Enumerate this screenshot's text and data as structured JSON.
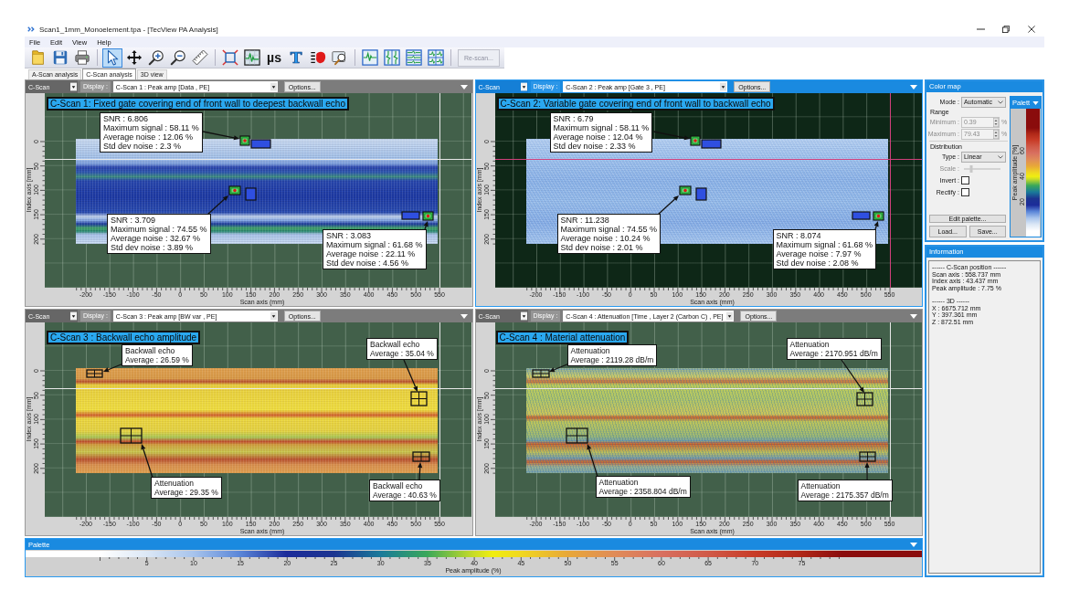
{
  "window": {
    "title": "Scan1_1mm_Monoelement.tpa - [TecView PA Analysis]"
  },
  "menu": [
    "File",
    "Edit",
    "View",
    "Help"
  ],
  "toolbar": {
    "tools": [
      {
        "selected": false
      },
      {
        "selected": false
      },
      {
        "selected": false
      },
      {
        "selected": true
      },
      {
        "selected": false
      },
      {
        "selected": false
      },
      {
        "selected": false
      },
      {
        "selected": false
      },
      {
        "selected": false
      },
      {
        "selected": false
      },
      {
        "label": "µs",
        "selected": false
      },
      {
        "label": "T",
        "selected": false
      },
      {
        "selected": false
      },
      {
        "selected": false
      },
      {
        "selected": false
      },
      {
        "selected": false
      },
      {
        "selected": false
      },
      {
        "selected": false
      }
    ],
    "rescan_button": {
      "label": "Re-scan...",
      "disabled": true
    }
  },
  "tabs": [
    {
      "label": "A-Scan analysis",
      "selected": false
    },
    {
      "label": "C-Scan analysis",
      "selected": true
    },
    {
      "label": "3D view",
      "selected": false
    }
  ],
  "cscan_panels": [
    {
      "selected": false,
      "view": "C-Scan",
      "display_label": "Display :",
      "display": "C-Scan 1 : Peak amp [Data , PE]",
      "options": "Options...",
      "title": "C-Scan 1: Fixed gate covering end of front wall to deepest backwall echo",
      "annotations": [
        {
          "kind": "snr",
          "lines": [
            "SNR : 6.806",
            "Maximum signal : 58.11 %",
            "Average noise : 12.06 %",
            "Std dev noise : 2.3 %"
          ]
        },
        {
          "kind": "snr",
          "lines": [
            "SNR : 3.709",
            "Maximum signal : 74.55 %",
            "Average noise : 32.67 %",
            "Std dev noise : 3.89 %"
          ]
        },
        {
          "kind": "snr",
          "lines": [
            "SNR : 3.083",
            "Maximum signal : 61.68 %",
            "Average noise : 22.11 %",
            "Std dev noise : 4.56 %"
          ]
        }
      ],
      "y_axis": {
        "label": "Index axis [mm]",
        "ticks": [
          "0",
          "50",
          "100",
          "150",
          "200"
        ]
      },
      "x_axis": {
        "label": "Scan axis (mm)",
        "ticks": [
          "-200",
          "-150",
          "-100",
          "-50",
          "0",
          "50",
          "100",
          "150",
          "200",
          "250",
          "300",
          "350",
          "400",
          "450",
          "500",
          "550"
        ]
      }
    },
    {
      "selected": true,
      "view": "C-Scan",
      "display_label": "Display :",
      "display": "C-Scan 2 : Peak amp [Gate 3 , PE]",
      "options": "Options...",
      "title": "C-Scan 2: Variable gate covering end of front wall to backwall echo",
      "annotations": [
        {
          "kind": "snr",
          "lines": [
            "SNR : 6.79",
            "Maximum signal : 58.11 %",
            "Average noise : 12.04 %",
            "Std dev noise : 2.33 %"
          ]
        },
        {
          "kind": "snr",
          "lines": [
            "SNR : 11.238",
            "Maximum signal : 74.55 %",
            "Average noise : 10.24 %",
            "Std dev noise : 2.01 %"
          ]
        },
        {
          "kind": "snr",
          "lines": [
            "SNR : 8.074",
            "Maximum signal : 61.68 %",
            "Average noise : 7.97 %",
            "Std dev noise : 2.08 %"
          ]
        }
      ],
      "y_axis": {
        "label": "Index axis [mm]",
        "ticks": [
          "0",
          "50",
          "100",
          "150",
          "200"
        ]
      },
      "x_axis": {
        "label": "Scan axis (mm)",
        "ticks": [
          "-200",
          "-150",
          "-100",
          "-50",
          "0",
          "50",
          "100",
          "150",
          "200",
          "250",
          "300",
          "350",
          "400",
          "450",
          "500",
          "550"
        ]
      }
    },
    {
      "selected": false,
      "view": "C-Scan",
      "display_label": "Display :",
      "display": "C-Scan 3 : Peak amp [BW var , PE]",
      "options": "Options...",
      "title": "C-Scan 3 : Backwall echo amplitude",
      "annotations": [
        {
          "kind": "average",
          "lines": [
            "Backwall echo",
            "Average : 26.59 %"
          ]
        },
        {
          "kind": "average",
          "lines": [
            "Backwall echo",
            "Average : 35.04 %"
          ]
        },
        {
          "kind": "average",
          "lines": [
            "Attenuation",
            "Average : 29.35 %"
          ]
        },
        {
          "kind": "average",
          "lines": [
            "Backwall echo",
            "Average : 40.63 %"
          ]
        }
      ],
      "y_axis": {
        "label": "Index axis [mm]",
        "ticks": [
          "0",
          "50",
          "100",
          "150",
          "200"
        ]
      },
      "x_axis": {
        "label": "Scan axis (mm)",
        "ticks": [
          "-200",
          "-150",
          "-100",
          "-50",
          "0",
          "50",
          "100",
          "150",
          "200",
          "250",
          "300",
          "350",
          "400",
          "450",
          "500",
          "550"
        ]
      }
    },
    {
      "selected": false,
      "view": "C-Scan",
      "display_label": "Display :",
      "display": "C-Scan 4 : Attenuation [Time , Layer 2 (Carbon C) , PE]",
      "options": "Options...",
      "title": "C-Scan 4 : Material attenuation",
      "annotations": [
        {
          "kind": "average",
          "lines": [
            "Attenuation",
            "Average : 2119.28 dB/m"
          ]
        },
        {
          "kind": "average",
          "lines": [
            "Attenuation",
            "Average : 2170.951 dB/m"
          ]
        },
        {
          "kind": "average",
          "lines": [
            "Attenuation",
            "Average : 2358.804 dB/m"
          ]
        },
        {
          "kind": "average",
          "lines": [
            "Attenuation",
            "Average : 2175.357 dB/m"
          ]
        }
      ],
      "y_axis": {
        "label": "Index axis [mm]",
        "ticks": [
          "0",
          "50",
          "100",
          "150",
          "200"
        ]
      },
      "x_axis": {
        "label": "Scan axis (mm)",
        "ticks": [
          "-200",
          "-150",
          "-100",
          "-50",
          "0",
          "50",
          "100",
          "150",
          "200",
          "250",
          "300",
          "350",
          "400",
          "450",
          "500",
          "550"
        ]
      }
    }
  ],
  "palette": {
    "title": "Palette",
    "ticks": [
      "5",
      "10",
      "15",
      "20",
      "25",
      "30",
      "35",
      "40",
      "45",
      "50",
      "55",
      "60",
      "65",
      "70",
      "75"
    ],
    "label": "Peak amplitude (%)"
  },
  "color_map": {
    "title": "Color map",
    "mode": {
      "label": "Mode :",
      "value": "Automatic"
    },
    "range_heading": "Range",
    "minimum": {
      "label": "Minimum :",
      "value": "0.39",
      "unit": "%",
      "disabled": true
    },
    "maximum": {
      "label": "Maximum :",
      "value": "79.43",
      "unit": "%",
      "disabled": true
    },
    "distribution_heading": "Distribution",
    "type": {
      "label": "Type :",
      "value": "Linear"
    },
    "scale": {
      "label": "Scale :",
      "disabled": true,
      "level": 0.2
    },
    "invert": {
      "label": "Invert :",
      "checked": false
    },
    "rectify": {
      "label": "Rectify :",
      "checked": false
    },
    "buttons": [
      "Edit palette...",
      "Load...",
      "Save..."
    ],
    "palette": {
      "title": "Palett",
      "label": "Peak amplitude [%]",
      "ticks": [
        "60",
        "40",
        "20"
      ]
    }
  },
  "information": {
    "title": "Information",
    "sections": [
      {
        "heading": "------ C-Scan position ------",
        "lines": [
          "Scan axis : 558.737 mm",
          "Index axis : 43.437 mm",
          "Peak amplitude : 7.75 %"
        ]
      },
      {
        "heading": "------ 3D ------",
        "lines": [
          "X : 6675.712 mm",
          "Y : 397.361 mm",
          "Z : 872.51 mm"
        ]
      }
    ]
  }
}
